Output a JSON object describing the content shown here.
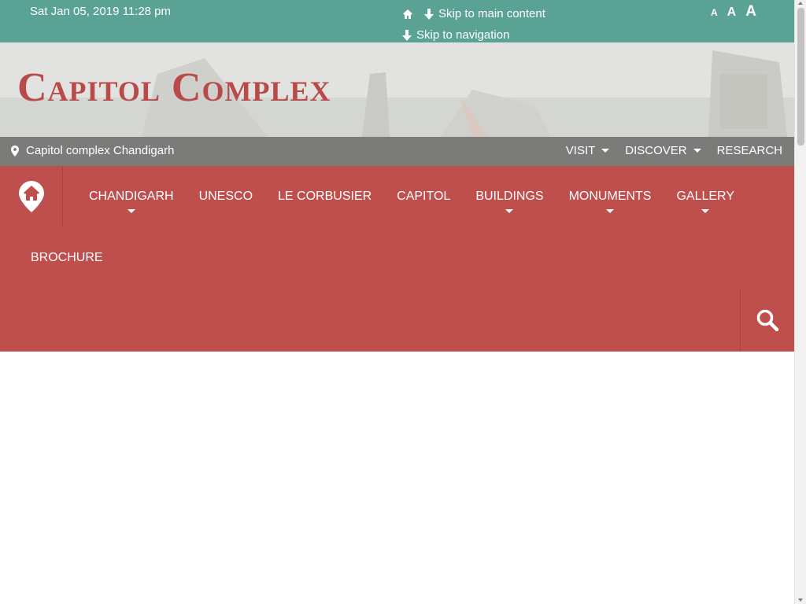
{
  "topbar": {
    "datetime": "Sat Jan 05, 2019 11:28 pm",
    "skip_main": "Skip to main content",
    "skip_nav": "Skip to navigation",
    "font_sizes": [
      "A",
      "A",
      "A"
    ],
    "color": "#5aa394"
  },
  "banner": {
    "title": "Capitol Complex",
    "title_color": "#b84b4a"
  },
  "greybar": {
    "location": "Capitol complex Chandigarh",
    "items": [
      {
        "label": "VISIT"
      },
      {
        "label": "DISCOVER"
      },
      {
        "label": "RESEARCH"
      }
    ]
  },
  "nav": {
    "color": "#bf4f4c",
    "items": [
      {
        "label": "CHANDIGARH"
      },
      {
        "label": "UNESCO"
      },
      {
        "label": "LE CORBUSIER"
      },
      {
        "label": "CAPITOL"
      },
      {
        "label": "BUILDINGS"
      },
      {
        "label": "MONUMENTS"
      },
      {
        "label": "GALLERY"
      }
    ],
    "extra": "BROCHURE"
  }
}
